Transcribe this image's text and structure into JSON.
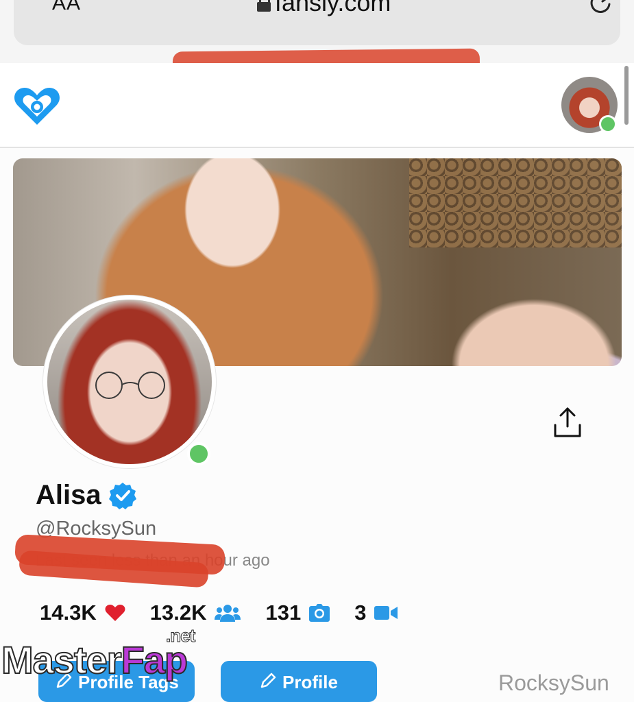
{
  "browser": {
    "text_size_label": "AA",
    "url": "fansly.com"
  },
  "profile": {
    "display_name": "Alisa",
    "handle": "@RocksySun",
    "last_seen": "Last seen less than an hour ago"
  },
  "stats": {
    "likes": "14.3K",
    "followers": "13.2K",
    "photos": "131",
    "videos": "3"
  },
  "buttons": {
    "profile_tags": "Profile Tags",
    "profile": "Profile"
  },
  "watermark": {
    "right_text": "RocksySun",
    "brand_master": "Master",
    "brand_fap": "Fap",
    "brand_net": ".net"
  },
  "colors": {
    "accent": "#2b99e6",
    "online": "#5fc564",
    "heart": "#e0202e",
    "redaction": "#d9432a"
  },
  "icons": [
    "lock-icon",
    "reload-icon",
    "fansly-logo-icon",
    "share-icon",
    "verified-icon",
    "heart-icon",
    "followers-icon",
    "camera-icon",
    "video-icon",
    "pencil-icon"
  ]
}
